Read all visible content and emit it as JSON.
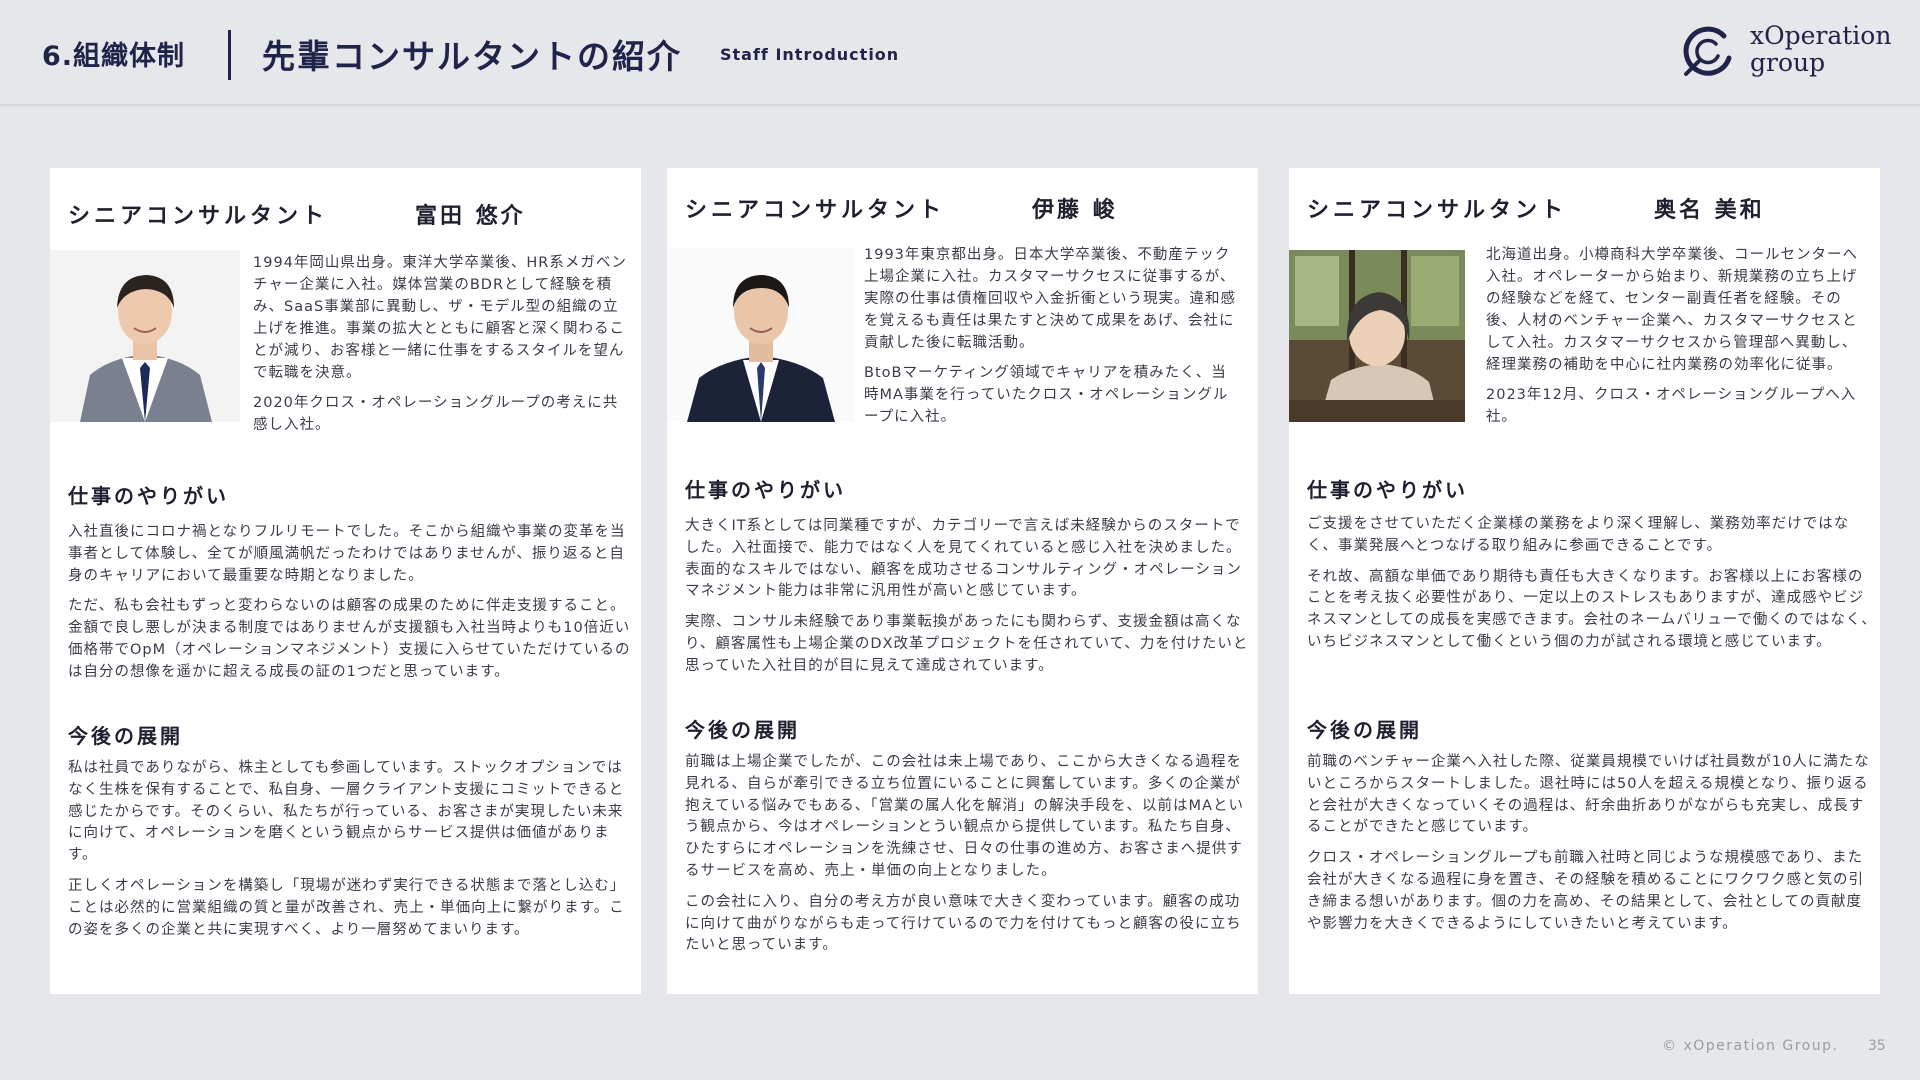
{
  "header": {
    "section_number": "6.組織体制",
    "title": "先輩コンサルタントの紹介",
    "subtitle": "Staff Introduction",
    "logo_line1": "xOperation",
    "logo_line2": "group"
  },
  "cards": [
    {
      "role": "シニアコンサルタント",
      "name": "富田 悠介",
      "bio": [
        "1994年岡山県出身。東洋大学卒業後、HR系メガベンチャー企業に入社。媒体営業のBDRとして経験を積み、SaaS事業部に異動し、ザ・モデル型の組織の立上げを推進。事業の拡大とともに顧客と深く関わることが減り、お客様と一緒に仕事をするスタイルを望んで転職を決意。",
        "2020年クロス・オペレーショングループの考えに共感し入社。"
      ],
      "section1_title": "仕事のやりがい",
      "section1_paras": [
        "入社直後にコロナ禍となりフルリモートでした。そこから組織や事業の変革を当事者として体験し、全てが順風満帆だったわけではありませんが、振り返ると自身のキャリアにおいて最重要な時期となりました。",
        "ただ、私も会社もずっと変わらないのは顧客の成果のために伴走支援すること。金額で良し悪しが決まる制度ではありませんが支援額も入社当時よりも10倍近い価格帯でOpM（オペレーションマネジメント）支援に入らせていただけているのは自分の想像を遥かに超える成長の証の1つだと思っています。"
      ],
      "section2_title": "今後の展開",
      "section2_paras": [
        "私は社員でありながら、株主としても参画しています。ストックオプションではなく生株を保有することで、私自身、一層クライアント支援にコミットできると感じたからです。そのくらい、私たちが行っている、お客さまが実現したい未来に向けて、オペレーションを磨くという観点からサービス提供は価値があります。",
        "正しくオペレーションを構築し「現場が迷わず実行できる状態まで落とし込む」ことは必然的に営業組織の質と量が改善され、売上・単価向上に繋がります。この姿を多くの企業と共に実現すべく、より一層努めてまいります。"
      ]
    },
    {
      "role": "シニアコンサルタント",
      "name": "伊藤 峻",
      "bio": [
        "1993年東京都出身。日本大学卒業後、不動産テック上場企業に入社。カスタマーサクセスに従事するが、実際の仕事は債権回収や入金折衝という現実。違和感を覚えるも責任は果たすと決めて成果をあげ、会社に貢献した後に転職活動。",
        "BtoBマーケティング領域でキャリアを積みたく、当時MA事業を行っていたクロス・オペレーショングループに入社。"
      ],
      "section1_title": "仕事のやりがい",
      "section1_paras": [
        "大きくIT系としては同業種ですが、カテゴリーで言えば未経験からのスタートでした。入社面接で、能力ではなく人を見てくれていると感じ入社を決めました。表面的なスキルではない、顧客を成功させるコンサルティング・オペレーションマネジメント能力は非常に汎用性が高いと感じています。",
        "実際、コンサル未経験であり事業転換があったにも関わらず、支援金額は高くなり、顧客属性も上場企業のDX改革プロジェクトを任されていて、力を付けたいと思っていた入社目的が目に見えて達成されています。"
      ],
      "section2_title": "今後の展開",
      "section2_paras": [
        "前職は上場企業でしたが、この会社は未上場であり、ここから大きくなる過程を見れる、自らが牽引できる立ち位置にいることに興奮しています。多くの企業が抱えている悩みでもある、「営業の属人化を解消」の解決手段を、以前はMAという観点から、今はオペレーションとうい観点から提供しています。私たち自身、ひたすらにオペレーションを洗練させ、日々の仕事の進め方、お客さまへ提供するサービスを高め、売上・単価の向上となりました。",
        "この会社に入り、自分の考え方が良い意味で大きく変わっています。顧客の成功に向けて曲がりながらも走って行けているので力を付けてもっと顧客の役に立ちたいと思っています。"
      ]
    },
    {
      "role": "シニアコンサルタント",
      "name": "奥名 美和",
      "bio": [
        "北海道出身。小樽商科大学卒業後、コールセンターへ入社。オペレーターから始まり、新規業務の立ち上げの経験などを経て、センター副責任者を経験。その後、人材のベンチャー企業へ、カスタマーサクセスとして入社。カスタマーサクセスから管理部へ異動し、経理業務の補助を中心に社内業務の効率化に従事。",
        "2023年12月、クロス・オペレーショングループへ入社。"
      ],
      "section1_title": "仕事のやりがい",
      "section1_paras": [
        "ご支援をさせていただく企業様の業務をより深く理解し、業務効率だけではなく、事業発展へとつなげる取り組みに参画できることです。",
        "それ故、高額な単価であり期待も責任も大きくなります。お客様以上にお客様のことを考え抜く必要性があり、一定以上のストレスもありますが、達成感やビジネスマンとしての成長を実感できます。会社のネームバリューで働くのではなく、いちビジネスマンとして働くという個の力が試される環境と感じています。"
      ],
      "section2_title": "今後の展開",
      "section2_paras": [
        "前職のベンチャー企業へ入社した際、従業員規模でいけば社員数が10人に満たないところからスタートしました。退社時には50人を超える規模となり、振り返ると会社が大きくなっていくその過程は、紆余曲折ありがながらも充実し、成長することができたと感じています。",
        "クロス・オペレーショングループも前職入社時と同じような規模感であり、また会社が大きくなる過程に身を置き、その経験を積めることにワクワク感と気の引き締まる想いがあります。個の力を高め、その結果として、会社としての貢献度や影響力を大きくできるようにしていきたいと考えています。"
      ]
    }
  ],
  "footer": {
    "copyright": "© xOperation Group.",
    "page_number": "35"
  }
}
